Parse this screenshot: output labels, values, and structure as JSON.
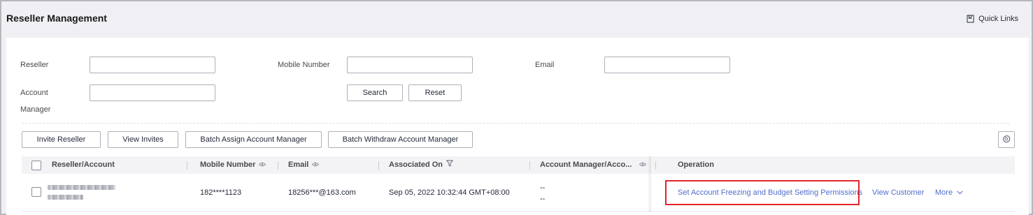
{
  "header": {
    "title": "Reseller Management",
    "quick_links": "Quick Links"
  },
  "filters": {
    "reseller_label": "Reseller",
    "mobile_label": "Mobile Number",
    "email_label": "Email",
    "account_manager_label_line1": "Account",
    "account_manager_label_line2": "Manager",
    "reseller_value": "",
    "mobile_value": "",
    "email_value": "",
    "account_manager_value": "",
    "search_button": "Search",
    "reset_button": "Reset"
  },
  "toolbar": {
    "invite_reseller": "Invite Reseller",
    "view_invites": "View Invites",
    "batch_assign": "Batch Assign Account Manager",
    "batch_withdraw": "Batch Withdraw Account Manager"
  },
  "table": {
    "columns": {
      "reseller_account": "Reseller/Account",
      "mobile_number": "Mobile Number",
      "email": "Email",
      "associated_on": "Associated On",
      "account_manager": "Account Manager/Acco...",
      "operation": "Operation"
    },
    "rows": [
      {
        "mobile_number": "182****1123",
        "email": "18256***@163.com",
        "associated_on": "Sep 05, 2022 10:32:44 GMT+08:00",
        "account_manager_line1": "--",
        "account_manager_line2": "--",
        "op_permissions": "Set Account Freezing and Budget Setting Permissions",
        "op_view_customer": "View Customer",
        "op_more": "More"
      }
    ]
  },
  "colors": {
    "link": "#526ecc",
    "highlight_border": "#e0262b"
  },
  "icons": {
    "quick_links": "bookmark-icon",
    "settings": "gear-icon",
    "eye": "eye-icon",
    "filter": "filter-icon",
    "chevron": "chevron-down-icon"
  }
}
